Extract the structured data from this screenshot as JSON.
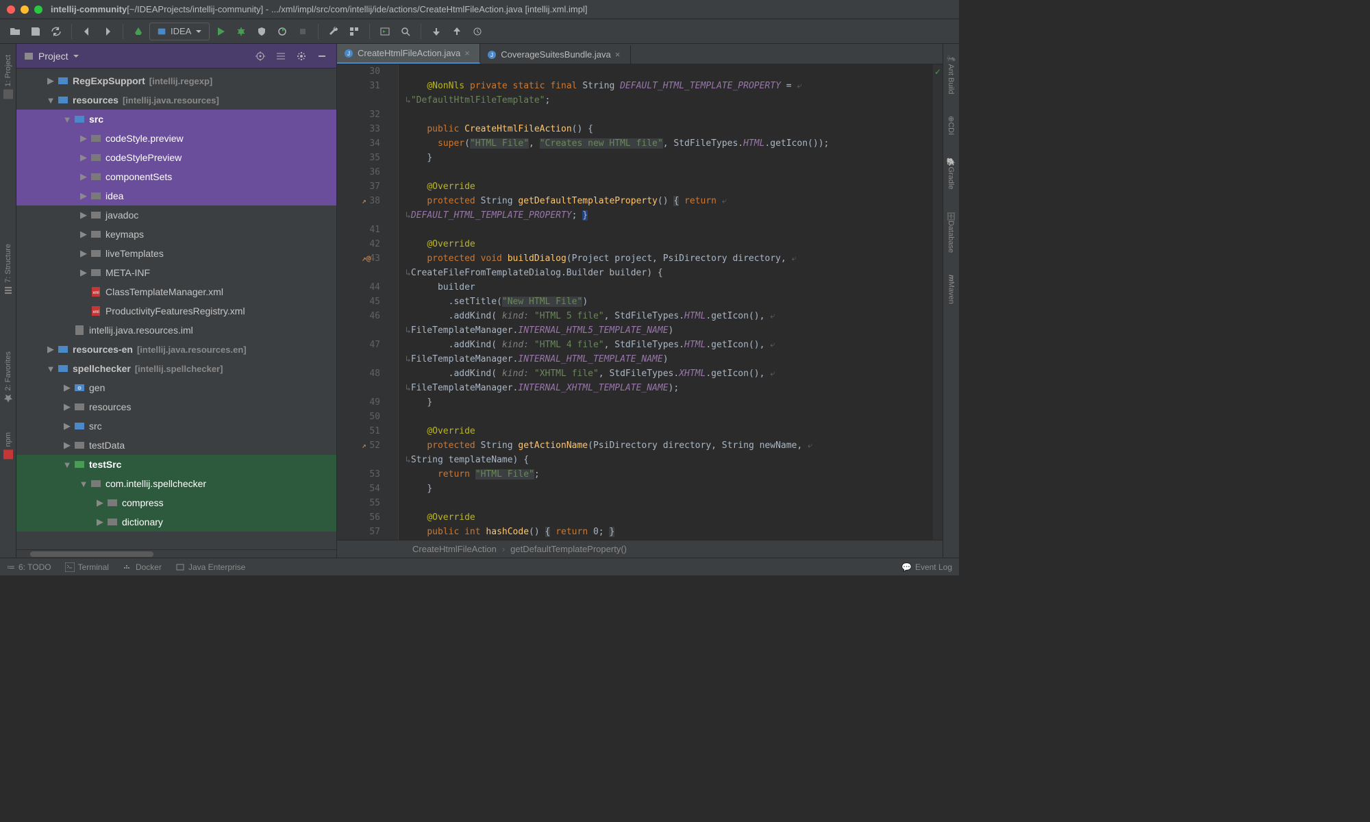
{
  "title": {
    "project": "intellij-community",
    "projectPath": "[~/IDEAProjects/intellij-community]",
    "sep": " - ",
    "filePath": ".../xml/impl/src/com/intellij/ide/actions/CreateHtmlFileAction.java",
    "module": " [intellij.xml.impl]"
  },
  "runConfig": "IDEA",
  "projectPanel": {
    "title": "Project"
  },
  "leftGutter": {
    "project": "1: Project",
    "structure": "7: Structure",
    "favorites": "2: Favorites",
    "npm": "npm"
  },
  "rightGutter": {
    "ant": "Ant Build",
    "cdi": "CDI",
    "gradle": "Gradle",
    "database": "Database",
    "maven": "Maven"
  },
  "tree": [
    {
      "indent": 1,
      "arrow": "▶",
      "icon": "module",
      "label": "RegExpSupport",
      "suffix": "[intellij.regexp]",
      "bold": true
    },
    {
      "indent": 1,
      "arrow": "▼",
      "icon": "module",
      "label": "resources",
      "suffix": "[intellij.java.resources]",
      "bold": true
    },
    {
      "indent": 2,
      "arrow": "▼",
      "icon": "src",
      "label": "src",
      "sel": "purple",
      "bold": true
    },
    {
      "indent": 3,
      "arrow": "▶",
      "icon": "pkg",
      "label": "codeStyle.preview",
      "sel": "purple"
    },
    {
      "indent": 3,
      "arrow": "▶",
      "icon": "pkg",
      "label": "codeStylePreview",
      "sel": "purple"
    },
    {
      "indent": 3,
      "arrow": "▶",
      "icon": "pkg",
      "label": "componentSets",
      "sel": "purple"
    },
    {
      "indent": 3,
      "arrow": "▶",
      "icon": "pkg",
      "label": "idea",
      "sel": "purple"
    },
    {
      "indent": 3,
      "arrow": "▶",
      "icon": "pkg",
      "label": "javadoc"
    },
    {
      "indent": 3,
      "arrow": "▶",
      "icon": "pkg",
      "label": "keymaps"
    },
    {
      "indent": 3,
      "arrow": "▶",
      "icon": "pkg",
      "label": "liveTemplates"
    },
    {
      "indent": 3,
      "arrow": "▶",
      "icon": "pkg",
      "label": "META-INF"
    },
    {
      "indent": 3,
      "arrow": "",
      "icon": "xml",
      "label": "ClassTemplateManager.xml"
    },
    {
      "indent": 3,
      "arrow": "",
      "icon": "xml",
      "label": "ProductivityFeaturesRegistry.xml"
    },
    {
      "indent": 2,
      "arrow": "",
      "icon": "iml",
      "label": "intellij.java.resources.iml"
    },
    {
      "indent": 1,
      "arrow": "▶",
      "icon": "module",
      "label": "resources-en",
      "suffix": "[intellij.java.resources.en]",
      "bold": true
    },
    {
      "indent": 1,
      "arrow": "▼",
      "icon": "module",
      "label": "spellchecker",
      "suffix": "[intellij.spellchecker]",
      "bold": true
    },
    {
      "indent": 2,
      "arrow": "▶",
      "icon": "gen",
      "label": "gen"
    },
    {
      "indent": 2,
      "arrow": "▶",
      "icon": "res",
      "label": "resources"
    },
    {
      "indent": 2,
      "arrow": "▶",
      "icon": "src",
      "label": "src"
    },
    {
      "indent": 2,
      "arrow": "▶",
      "icon": "folder",
      "label": "testData"
    },
    {
      "indent": 2,
      "arrow": "▼",
      "icon": "test",
      "label": "testSrc",
      "sel": "green",
      "bold": true
    },
    {
      "indent": 3,
      "arrow": "▼",
      "icon": "pkg",
      "label": "com.intellij.spellchecker",
      "sel": "green"
    },
    {
      "indent": 4,
      "arrow": "▶",
      "icon": "pkg",
      "label": "compress",
      "sel": "green"
    },
    {
      "indent": 4,
      "arrow": "▶",
      "icon": "pkg",
      "label": "dictionary",
      "sel": "green"
    }
  ],
  "tabs": [
    {
      "label": "CreateHtmlFileAction.java",
      "active": true
    },
    {
      "label": "CoverageSuitesBundle.java",
      "active": false
    }
  ],
  "lineNumbers": [
    "30",
    "31",
    "",
    "32",
    "33",
    "34",
    "35",
    "36",
    "37",
    "38",
    "",
    "41",
    "42",
    "43",
    "",
    "44",
    "45",
    "46",
    "",
    "47",
    "",
    "48",
    "",
    "49",
    "50",
    "51",
    "52",
    "",
    "53",
    "54",
    "55",
    "56",
    "57"
  ],
  "gutterMarks": {
    "9": "↗",
    "13": "↗@",
    "26": "↗"
  },
  "code": [
    "",
    "    <span class='c-ann'>@NonNls</span> <span class='c-kw'>private static final</span> <span class='c-txt'>String</span> <span class='c-const'>DEFAULT_HTML_TEMPLATE_PROPERTY</span> <span class='c-txt'>=</span> <span class='c-wrap'>⤶</span>",
    "<span class='c-wrap'>↳</span><span class='c-str'>\"DefaultHtmlFileTemplate\"</span><span class='c-txt'>;</span>",
    "",
    "    <span class='c-kw'>public</span> <span class='c-fn'>CreateHtmlFileAction</span><span class='c-txt'>() {</span>",
    "      <span class='c-kw'>super</span><span class='c-txt'>(</span><span class='c-str c-hl'>\"HTML File\"</span><span class='c-txt'>, </span><span class='c-str c-hl'>\"Creates new HTML file\"</span><span class='c-txt'>, StdFileTypes.</span><span class='c-const'>HTML</span><span class='c-txt'>.getIcon());</span>",
    "    <span class='c-txt'>}</span>",
    "",
    "    <span class='c-ann'>@Override</span>",
    "    <span class='c-kw'>protected</span> <span class='c-txt'>String </span><span class='c-fn'>getDefaultTemplateProperty</span><span class='c-txt'>()</span> <span class='c-txt c-hl'>{</span> <span class='c-kw'>return</span> <span class='c-wrap'>⤶</span>",
    "<span class='c-wrap'>↳</span><span class='c-const'>DEFAULT_HTML_TEMPLATE_PROPERTY</span><span class='c-txt'>;</span> <span class='c-txt c-cursor'>}</span>",
    "",
    "    <span class='c-ann'>@Override</span>",
    "    <span class='c-kw'>protected void</span> <span class='c-fn'>buildDialog</span><span class='c-txt'>(Project project, PsiDirectory directory, </span><span class='c-wrap'>⤶</span>",
    "<span class='c-wrap'>↳</span><span class='c-txt'>CreateFileFromTemplateDialog.Builder builder) {</span>",
    "      <span class='c-txt'>builder</span>",
    "        <span class='c-txt'>.setTitle(</span><span class='c-str c-hl'>\"New HTML File\"</span><span class='c-txt'>)</span>",
    "        <span class='c-txt'>.addKind(</span> <span class='c-param'>kind:</span> <span class='c-str'>\"HTML 5 file\"</span><span class='c-txt'>, StdFileTypes.</span><span class='c-const'>HTML</span><span class='c-txt'>.getIcon(), </span><span class='c-wrap'>⤶</span>",
    "<span class='c-wrap'>↳</span><span class='c-txt'>FileTemplateManager.</span><span class='c-const'>INTERNAL_HTML5_TEMPLATE_NAME</span><span class='c-txt'>)</span>",
    "        <span class='c-txt'>.addKind(</span> <span class='c-param'>kind:</span> <span class='c-str'>\"HTML 4 file\"</span><span class='c-txt'>, StdFileTypes.</span><span class='c-const'>HTML</span><span class='c-txt'>.getIcon(), </span><span class='c-wrap'>⤶</span>",
    "<span class='c-wrap'>↳</span><span class='c-txt'>FileTemplateManager.</span><span class='c-const'>INTERNAL_HTML_TEMPLATE_NAME</span><span class='c-txt'>)</span>",
    "        <span class='c-txt'>.addKind(</span> <span class='c-param'>kind:</span> <span class='c-str'>\"XHTML file\"</span><span class='c-txt'>, StdFileTypes.</span><span class='c-const'>XHTML</span><span class='c-txt'>.getIcon(), </span><span class='c-wrap'>⤶</span>",
    "<span class='c-wrap'>↳</span><span class='c-txt'>FileTemplateManager.</span><span class='c-const'>INTERNAL_XHTML_TEMPLATE_NAME</span><span class='c-txt'>);</span>",
    "    <span class='c-txt'>}</span>",
    "",
    "    <span class='c-ann'>@Override</span>",
    "    <span class='c-kw'>protected</span> <span class='c-txt'>String </span><span class='c-fn'>getActionName</span><span class='c-txt'>(PsiDirectory directory, String newName, </span><span class='c-wrap'>⤶</span>",
    "<span class='c-wrap'>↳</span><span class='c-txt'>String templateName) {</span>",
    "      <span class='c-kw'>return</span> <span class='c-str c-hl'>\"HTML File\"</span><span class='c-txt'>;</span>",
    "    <span class='c-txt'>}</span>",
    "",
    "    <span class='c-ann'>@Override</span>",
    "    <span class='c-kw'>public int</span> <span class='c-fn'>hashCode</span><span class='c-txt'>()</span> <span class='c-txt c-hl'>{</span> <span class='c-kw'>return</span> <span class='c-txt'>0;</span> <span class='c-txt c-hl'>}</span>"
  ],
  "breadcrumb": {
    "a": "CreateHtmlFileAction",
    "b": "getDefaultTemplateProperty()"
  },
  "statusBar": {
    "todo": "6: TODO",
    "terminal": "Terminal",
    "docker": "Docker",
    "je": "Java Enterprise",
    "eventLog": "Event Log"
  }
}
